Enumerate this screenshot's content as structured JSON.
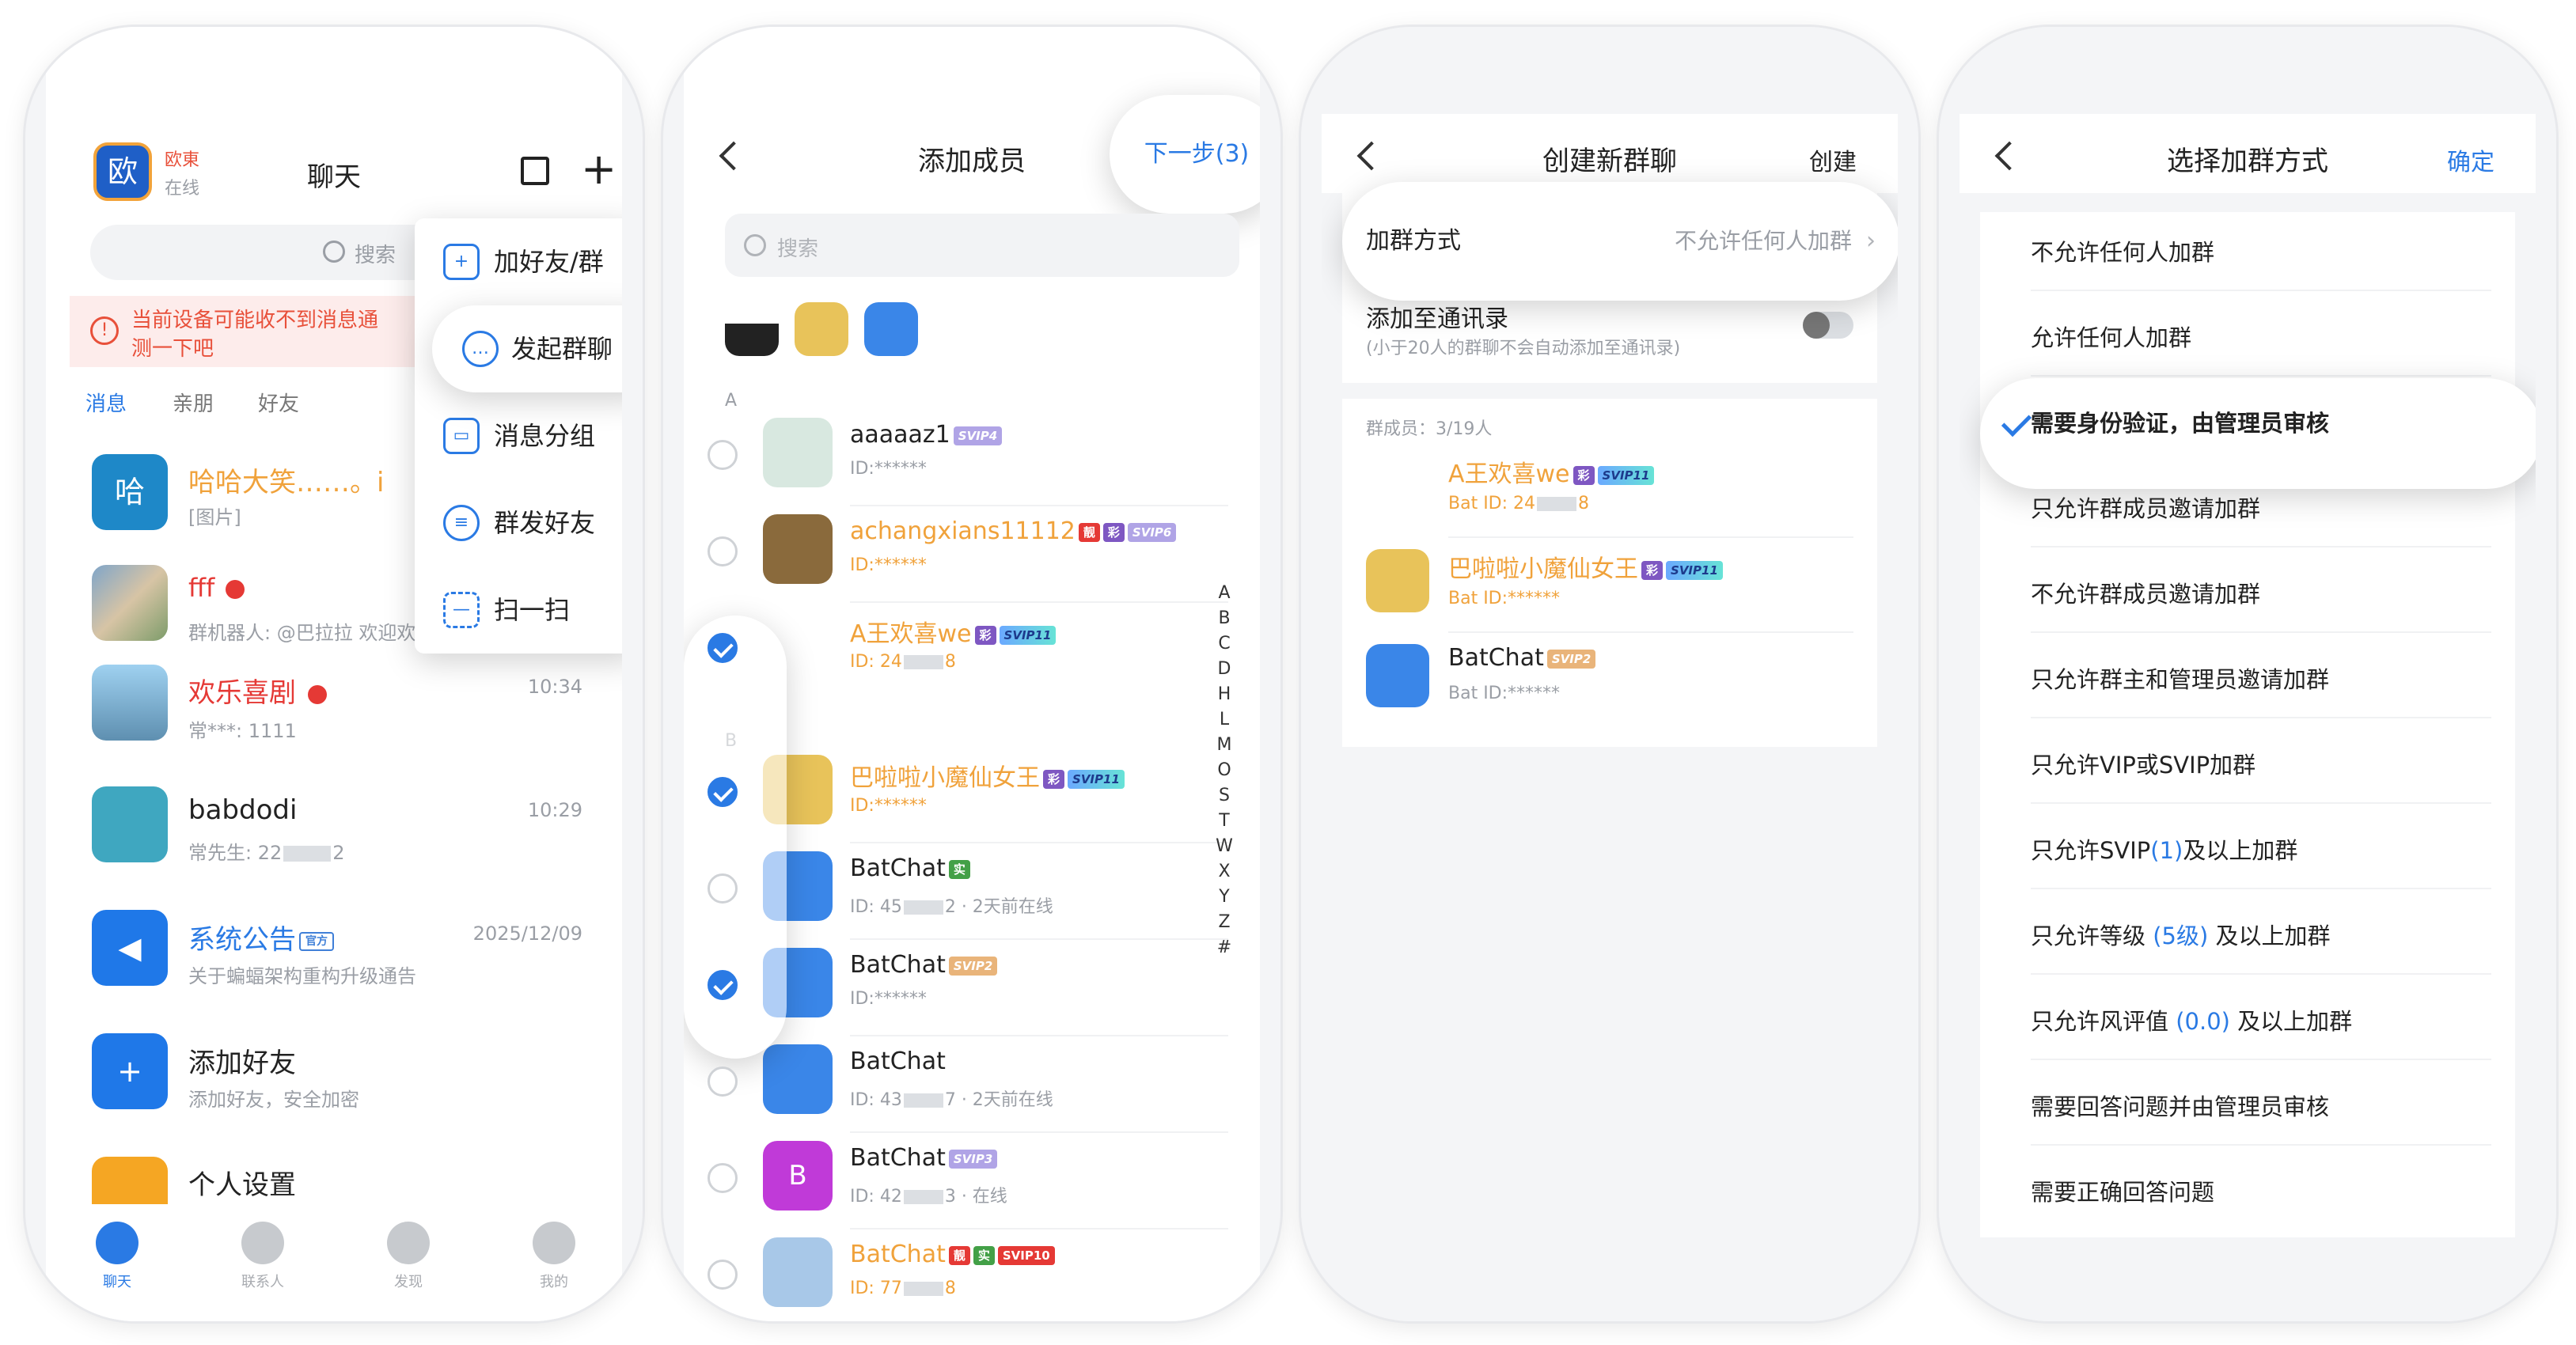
{
  "colors": {
    "accent": "#2a7ae4",
    "nickname_gold": "#f0a23b",
    "warning": "#e8503a",
    "warning_bg": "#fdeceb"
  },
  "chat_screen": {
    "app_name": "欧東",
    "avatar_char": "欧",
    "status": "在线",
    "title": "聊天",
    "search_placeholder": "搜索",
    "warning": "当前设备可能收不到消息通",
    "warning_line2": "测一下吧",
    "tabs": [
      "消息",
      "亲朋",
      "好友"
    ],
    "menu": [
      {
        "label": "加好友/群",
        "icon": "add-friend-icon"
      },
      {
        "label": "发起群聊",
        "icon": "group-chat-icon"
      },
      {
        "label": "消息分组",
        "icon": "message-group-icon"
      },
      {
        "label": "群发好友",
        "icon": "broadcast-icon"
      },
      {
        "label": "扫一扫",
        "icon": "scan-icon"
      }
    ],
    "conversations": [
      {
        "avatar": "哈",
        "name": "哈哈大笑……。i",
        "preview": "[图片]",
        "time": "",
        "name_color": "#f0a23b"
      },
      {
        "avatar": "",
        "name": "fff",
        "preview": "群机器人: @巴拉拉 欢迎欢迎",
        "time": "",
        "name_color": "#e53935"
      },
      {
        "avatar": "",
        "name": "欢乐喜剧",
        "preview": "常***: 1111",
        "time": "10:34",
        "name_color": "#e53935"
      },
      {
        "avatar": "",
        "name": "babdodi",
        "preview": "常先生: 22",
        "preview_tail": "2",
        "time": "10:29",
        "name_color": "#222222"
      },
      {
        "avatar": "",
        "name": "系统公告",
        "badge": "官方",
        "preview": "关于蝙蝠架构重构升级通告",
        "time": "2025/12/09",
        "name_color": "#2a7ae4"
      },
      {
        "avatar": "",
        "name": "添加好友",
        "preview": "添加好友，安全加密",
        "time": "",
        "name_color": "#222222"
      },
      {
        "avatar": "",
        "name": "个人设置",
        "preview": "",
        "time": "",
        "name_color": "#222222"
      }
    ],
    "tabbar": [
      "聊天",
      "联系人",
      "发现",
      "我的"
    ]
  },
  "add_member_screen": {
    "title": "添加成员",
    "next": "下一步(3)",
    "search_placeholder": "搜索",
    "section_a": "A",
    "section_b": "B",
    "index": [
      "A",
      "B",
      "C",
      "D",
      "H",
      "L",
      "M",
      "O",
      "S",
      "T",
      "W",
      "X",
      "Y",
      "Z",
      "#"
    ],
    "contacts": [
      {
        "name": "aaaaaz1",
        "id": "ID:******",
        "checked": false,
        "badges": [
          "SVIP4"
        ],
        "name_color": "#222222"
      },
      {
        "name": "achangxians11112",
        "id": "ID:******",
        "checked": false,
        "badges": [
          "靓",
          "彩",
          "SVIP6"
        ],
        "name_color": "#f0a23b"
      },
      {
        "name": "A王欢喜we",
        "id": "ID: 24",
        "id_tail": "8",
        "checked": true,
        "badges": [
          "彩",
          "SVIP11"
        ],
        "name_color": "#f0a23b"
      },
      {
        "name": "巴啦啦小魔仙女王",
        "id": "ID:******",
        "checked": true,
        "badges": [
          "彩",
          "SVIP11"
        ],
        "name_color": "#f0a23b"
      },
      {
        "name": "BatChat",
        "id": "ID: 45",
        "id_tail": "2 · 2天前在线",
        "checked": false,
        "badges": [
          "实"
        ],
        "name_color": "#222222"
      },
      {
        "name": "BatChat",
        "id": "ID:******",
        "checked": true,
        "badges": [
          "SVIP2"
        ],
        "name_color": "#222222"
      },
      {
        "name": "BatChat",
        "id": "ID: 43",
        "id_tail": "7 · 2天前在线",
        "checked": false,
        "badges": [],
        "name_color": "#222222"
      },
      {
        "name": "BatChat",
        "id": "ID: 42",
        "id_tail": "3 · 在线",
        "checked": false,
        "badges": [
          "SVIP3"
        ],
        "name_color": "#222222",
        "avatar": "B"
      },
      {
        "name": "BatChat",
        "id": "ID: 77",
        "id_tail": "8",
        "checked": false,
        "badges": [
          "靓",
          "实",
          "SVIP10"
        ],
        "name_color": "#f0a23b"
      }
    ]
  },
  "create_group_screen": {
    "title": "创建新群聊",
    "action": "创建",
    "join_label": "加群方式",
    "join_value": "不允许任何人加群",
    "contacts_label": "添加至通讯录",
    "contacts_hint": "(小于20人的群聊不会自动添加至通讯录)",
    "members_label": "群成员：3/19人",
    "members": [
      {
        "name": "A王欢喜we",
        "id": "Bat ID: 24",
        "id_tail": "8",
        "badges": [
          "彩",
          "SVIP11"
        ],
        "name_color": "#f0a23b"
      },
      {
        "name": "巴啦啦小魔仙女王",
        "id": "Bat ID:******",
        "badges": [
          "彩",
          "SVIP11"
        ],
        "name_color": "#f0a23b"
      },
      {
        "name": "BatChat",
        "id": "Bat ID:******",
        "badges": [
          "SVIP2"
        ],
        "name_color": "#222222"
      }
    ]
  },
  "join_method_screen": {
    "title": "选择加群方式",
    "action": "确定",
    "options": [
      {
        "label": "不允许任何人加群",
        "selected": false
      },
      {
        "label": "允许任何人加群",
        "selected": false
      },
      {
        "label": "需要身份验证，由管理员审核",
        "selected": true
      },
      {
        "label": "只允许群成员邀请加群",
        "selected": false
      },
      {
        "label": "不允许群成员邀请加群",
        "selected": false
      },
      {
        "label": "只允许群主和管理员邀请加群",
        "selected": false
      },
      {
        "label": "只允许VIP或SVIP加群",
        "selected": false
      },
      {
        "label": "只允许SVIP",
        "value": "(1)",
        "suffix": "及以上加群",
        "selected": false
      },
      {
        "label": "只允许等级 ",
        "value": "(5级)",
        "suffix": " 及以上加群",
        "selected": false
      },
      {
        "label": "只允许风评值 ",
        "value": "(0.0)",
        "suffix": " 及以上加群",
        "selected": false
      },
      {
        "label": "需要回答问题并由管理员审核",
        "selected": false
      },
      {
        "label": "需要正确回答问题",
        "selected": false
      }
    ]
  }
}
